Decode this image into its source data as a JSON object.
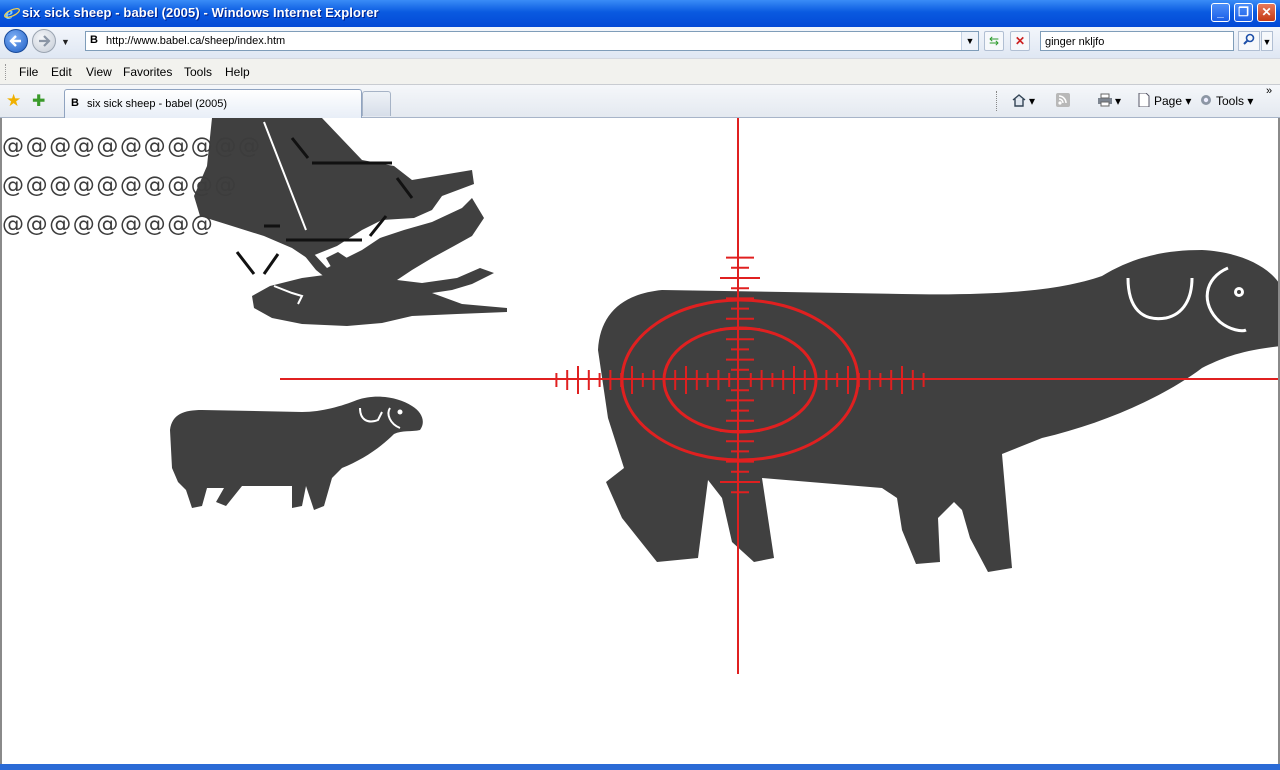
{
  "window": {
    "title": "six sick sheep - babel (2005) - Windows Internet Explorer",
    "controls": {
      "minimize": "_",
      "maximize": "❐",
      "close": "✕"
    }
  },
  "address_bar": {
    "url": "http://www.babel.ca/sheep/index.htm",
    "search_value": "ginger nkljfo"
  },
  "menu": {
    "items": [
      {
        "label": "File"
      },
      {
        "label": "Edit"
      },
      {
        "label": "View"
      },
      {
        "label": "Favorites"
      },
      {
        "label": "Tools"
      },
      {
        "label": "Help"
      }
    ]
  },
  "tabs": {
    "active_tab_label": "six sick sheep - babel (2005)",
    "favicon": "B"
  },
  "command_bar": {
    "page_label": "Page",
    "tools_label": "Tools"
  },
  "page": {
    "at_rows": [
      "@@@@@@@@@@@",
      "@@@@@@@@@@",
      "@@@@@@@@@"
    ],
    "colors": {
      "silhouette": "#404040",
      "crosshair": "#e02020"
    }
  }
}
